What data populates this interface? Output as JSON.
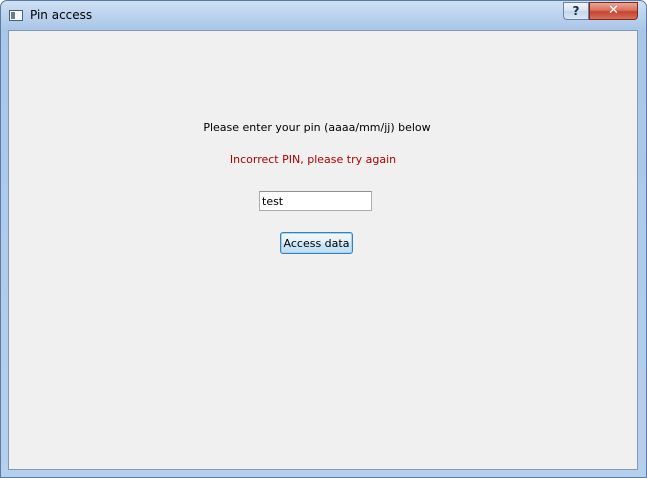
{
  "window": {
    "title": "Pin access",
    "help_label": "?",
    "close_label": "✕"
  },
  "form": {
    "prompt": "Please enter your pin (aaaa/mm/jj) below",
    "error": "Incorrect PIN, please try again",
    "pin_value": "test",
    "button_label": "Access data"
  },
  "icons": {
    "app": "application-window-icon",
    "help": "question-mark-icon",
    "close": "close-icon"
  },
  "colors": {
    "error_text": "#b00000",
    "client_background": "#f0f0f0",
    "button_border": "#3c7fb1"
  }
}
